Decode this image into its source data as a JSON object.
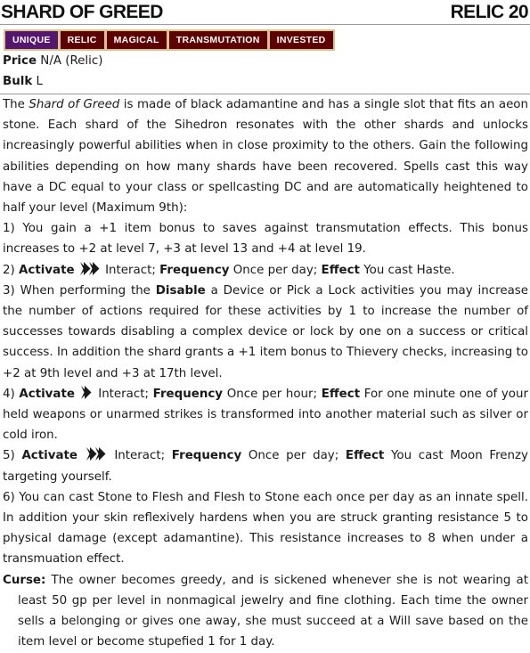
{
  "item": {
    "name": "SHARD OF GREED",
    "level": "RELIC 20",
    "traits": [
      {
        "label": "UNIQUE",
        "color": "#54166e"
      },
      {
        "label": "RELIC",
        "color": "#5e0000"
      },
      {
        "label": "MAGICAL",
        "color": "#5e0000"
      },
      {
        "label": "TRANSMUTATION",
        "color": "#5e0000"
      },
      {
        "label": "INVESTED",
        "color": "#5e0000"
      }
    ],
    "price_label": "Price",
    "price": "N/A (Relic)",
    "bulk_label": "Bulk",
    "bulk": "L"
  },
  "text": {
    "intro_pre": "The ",
    "intro_name": "Shard of Greed",
    "intro_post": " is made of black adamantine and has a single slot that fits an aeon stone. Each shard of the Sihedron resonates with the other shards and unlocks increasingly powerful abilities when in close proximity to the others. Gain the following abilities depending on how many shards have been recovered. Spells cast this way have a DC equal to your class or spellcasting DC and are automatically heightened to half your level (Maximum 9th):",
    "a1": "1) You gain a +1 item bonus to saves against transmutation effects. This bonus increases to +2 at level 7, +3 at level 13 and +4 at level 19.",
    "a2_num": "2) ",
    "a2_post": " Interact; ",
    "a2_freq": " Once per day; ",
    "a2_effect": " You cast Haste.",
    "a3_pre": "3) When performing the ",
    "a3_bold": "Disable",
    "a3_post": " a Device or Pick a Lock activities you may increase the number of actions required for these activities by 1 to increase the number of successes towards disabling a complex device or lock by one on a success or critical success. In addition the shard grants a +1 item bonus to Thievery checks, increasing to +2 at 9th level and +3 at 17th level.",
    "a4_num": "4) ",
    "a4_post": " Interact; ",
    "a4_freq": " Once per hour; ",
    "a4_effect": " For one minute one of your held weapons or unarmed strikes is transformed into another material such as silver or cold iron.",
    "a5_num": "5) ",
    "a5_post": " Interact; ",
    "a5_freq": " Once per day; ",
    "a5_effect": " You cast Moon Frenzy targeting yourself.",
    "a6": "6) You can cast Stone to Flesh and Flesh to Stone each once per day as an innate spell. In addition your skin reflexively hardens when you are struck granting resistance 5 to physical damage (except adamantine). This resistance increases to 8 when under a transmuation effect.",
    "activate_label": "Activate",
    "frequency_label": "Frequency",
    "effect_label": "Effect",
    "curse_label": "Curse:",
    "curse_text": " The owner becomes greedy, and is sickened whenever she is not wearing at least 50 gp per level in nonmagical jewelry and fine clothing. Each time the owner sells a belonging or gives one away, she must succeed at a Will save based on the item level or become stupefied 1 for 1 day."
  },
  "icons": {
    "one_action": "one-action-icon",
    "two_actions": "two-actions-icon"
  }
}
